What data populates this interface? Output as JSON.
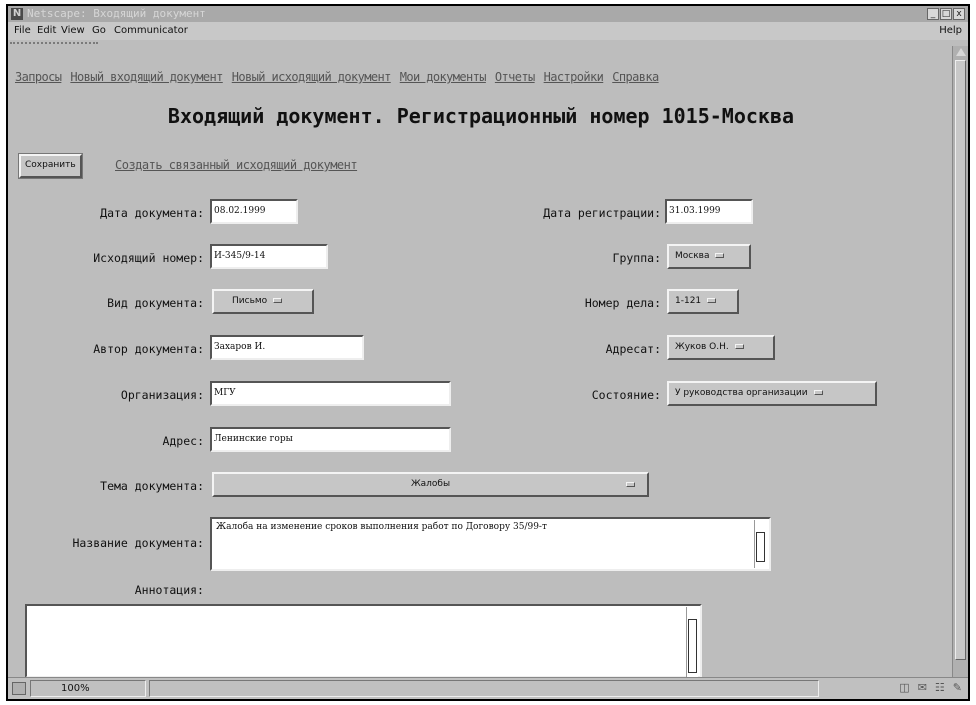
{
  "window": {
    "title": "Netscape: Входящий документ",
    "controls": [
      "_",
      "□",
      "x"
    ]
  },
  "menu": {
    "items": [
      "File",
      "Edit",
      "View",
      "Go",
      "Communicator"
    ],
    "help": "Help"
  },
  "nav": {
    "links": [
      "Запросы",
      "Новый входящий документ",
      "Новый исходящий документ",
      "Мои документы",
      "Отчеты",
      "Настройки",
      "Справка"
    ]
  },
  "page": {
    "heading": "Входящий документ. Регистрационный номер 1015-Москва",
    "save_button": "Сохранить",
    "related_link": "Создать связанный исходящий документ"
  },
  "form": {
    "doc_date": {
      "label": "Дата документа:",
      "value": "08.02.1999"
    },
    "reg_date": {
      "label": "Дата регистрации:",
      "value": "31.03.1999"
    },
    "out_number": {
      "label": "Исходящий номер:",
      "value": "И-345/9-14"
    },
    "group": {
      "label": "Группа:",
      "value": "Москва"
    },
    "doc_type": {
      "label": "Вид документа:",
      "value": "Письмо"
    },
    "case_number": {
      "label": "Номер дела:",
      "value": "1-121"
    },
    "author": {
      "label": "Автор документа:",
      "value": "Захаров И."
    },
    "addressee": {
      "label": "Адресат:",
      "value": "Жуков О.Н."
    },
    "organization": {
      "label": "Организация:",
      "value": "МГУ"
    },
    "state": {
      "label": "Состояние:",
      "value": "У руководства организации"
    },
    "address": {
      "label": "Адрес:",
      "value": "Ленинские горы"
    },
    "topic": {
      "label": "Тема документа:",
      "value": "Жалобы"
    },
    "doc_name": {
      "label": "Название документа:",
      "value": "Жалоба на изменение сроков выполнения работ по Договору 35/99-т"
    },
    "annotation": {
      "label": "Аннотация:",
      "value": ""
    }
  },
  "status": {
    "zoom": "100%"
  }
}
